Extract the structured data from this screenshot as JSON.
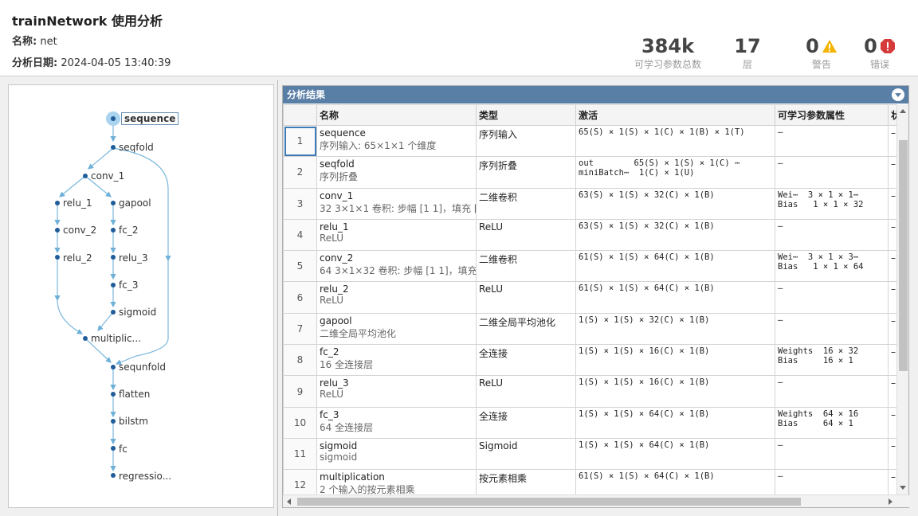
{
  "header": {
    "title": "trainNetwork 使用分析",
    "name_label": "名称:",
    "name_value": "net",
    "date_label": "分析日期:",
    "date_value": "2024-04-05 13:40:39"
  },
  "stats": {
    "params_value": "384k",
    "params_label": "可学习参数总数",
    "layers_value": "17",
    "layers_label": "层",
    "warnings_value": "0",
    "warnings_label": "警告",
    "errors_value": "0",
    "errors_label": "错误"
  },
  "graph": {
    "nodes": [
      "sequence",
      "seqfold",
      "conv_1",
      "relu_1",
      "gapool",
      "conv_2",
      "fc_2",
      "relu_2",
      "relu_3",
      "fc_3",
      "sigmoid",
      "multiplic...",
      "sequnfold",
      "flatten",
      "bilstm",
      "fc",
      "regressio..."
    ],
    "selected": "sequence",
    "accent_color": "#1f5c99"
  },
  "results": {
    "title": "分析结果",
    "columns": [
      "",
      "名称",
      "类型",
      "激活",
      "可学习参数属性",
      "状"
    ],
    "rows": [
      {
        "idx": "1",
        "name": "sequence",
        "desc": "序列输入: 65×1×1 个维度",
        "type": "序列输入",
        "act": "65(S) × 1(S) × 1(C) × 1(B) × 1(T)",
        "lp": "–",
        "st": "–"
      },
      {
        "idx": "2",
        "name": "seqfold",
        "desc": "序列折叠",
        "type": "序列折叠",
        "act": "out        65(S) × 1(S) × 1(C) ⋯\nminiBatch⋯  1(C) × 1(U)",
        "lp": "–",
        "st": "–"
      },
      {
        "idx": "3",
        "name": "conv_1",
        "desc": "32 3×1×1 卷积: 步幅 [1 1]，填充 [...",
        "type": "二维卷积",
        "act": "63(S) × 1(S) × 32(C) × 1(B)",
        "lp": "Wei⋯  3 × 1 × 1⋯\nBias   1 × 1 × 32",
        "st": "–"
      },
      {
        "idx": "4",
        "name": "relu_1",
        "desc": "ReLU",
        "type": "ReLU",
        "act": "63(S) × 1(S) × 32(C) × 1(B)",
        "lp": "–",
        "st": "–"
      },
      {
        "idx": "5",
        "name": "conv_2",
        "desc": "64 3×1×32 卷积: 步幅 [1 1]，填充...",
        "type": "二维卷积",
        "act": "61(S) × 1(S) × 64(C) × 1(B)",
        "lp": "Wei⋯  3 × 1 × 3⋯\nBias   1 × 1 × 64",
        "st": "–"
      },
      {
        "idx": "6",
        "name": "relu_2",
        "desc": "ReLU",
        "type": "ReLU",
        "act": "61(S) × 1(S) × 64(C) × 1(B)",
        "lp": "–",
        "st": "–"
      },
      {
        "idx": "7",
        "name": "gapool",
        "desc": "二维全局平均池化",
        "type": "二维全局平均池化",
        "act": "1(S) × 1(S) × 32(C) × 1(B)",
        "lp": "–",
        "st": "–"
      },
      {
        "idx": "8",
        "name": "fc_2",
        "desc": "16 全连接层",
        "type": "全连接",
        "act": "1(S) × 1(S) × 16(C) × 1(B)",
        "lp": "Weights  16 × 32\nBias     16 × 1",
        "st": "–"
      },
      {
        "idx": "9",
        "name": "relu_3",
        "desc": "ReLU",
        "type": "ReLU",
        "act": "1(S) × 1(S) × 16(C) × 1(B)",
        "lp": "–",
        "st": "–"
      },
      {
        "idx": "10",
        "name": "fc_3",
        "desc": "64 全连接层",
        "type": "全连接",
        "act": "1(S) × 1(S) × 64(C) × 1(B)",
        "lp": "Weights  64 × 16\nBias     64 × 1",
        "st": "–"
      },
      {
        "idx": "11",
        "name": "sigmoid",
        "desc": "sigmoid",
        "type": "Sigmoid",
        "act": "1(S) × 1(S) × 64(C) × 1(B)",
        "lp": "–",
        "st": "–"
      },
      {
        "idx": "12",
        "name": "multiplication",
        "desc": "2 个输入的按元素相乘",
        "type": "按元素相乘",
        "act": "61(S) × 1(S) × 64(C) × 1(B)",
        "lp": "–",
        "st": "–"
      }
    ]
  }
}
